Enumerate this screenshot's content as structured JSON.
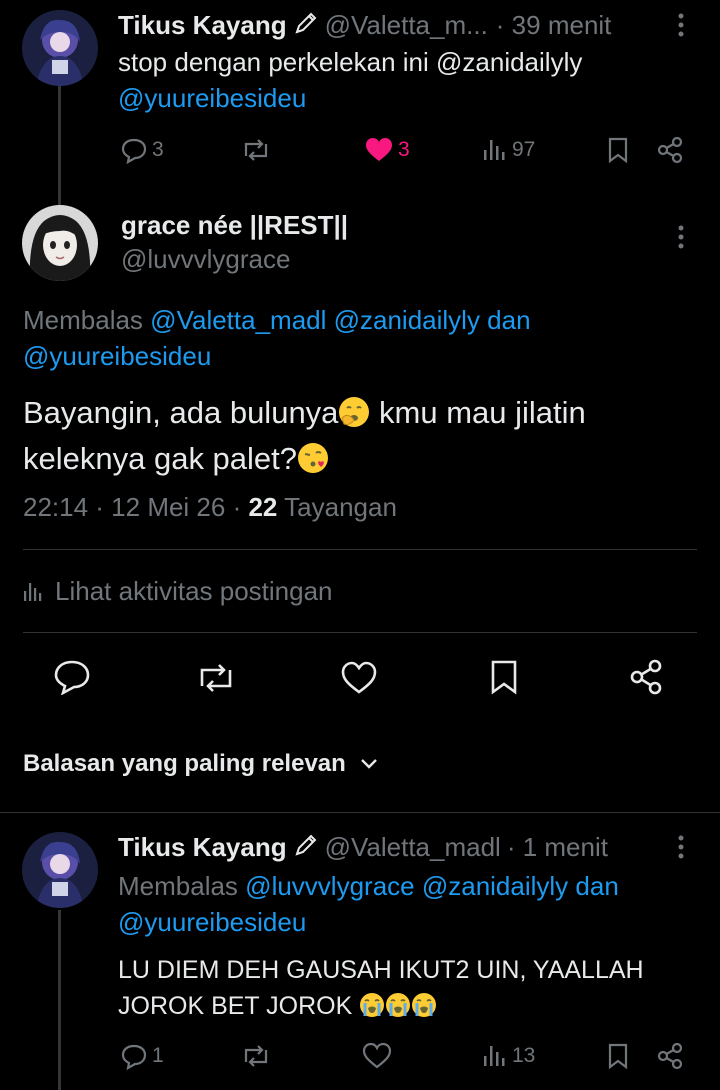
{
  "tweet1": {
    "display_name": "Tikus Kayang",
    "handle": "@Valetta_m...",
    "time": "· 39 menit",
    "text_line1": "stop dengan perkelekan ini @zanidailyly",
    "mention2": "@yuureibesideu",
    "replies": "3",
    "likes": "3",
    "views": "97",
    "more_icon": "more-vertical-icon"
  },
  "main_tweet": {
    "display_name": "grace née ||REST||",
    "handle": "@luvvvlygrace",
    "reply_prefix": "Membalas",
    "reply_mentions_line1": "@Valetta_madl @zanidailyly dan",
    "reply_mentions_line2": "@yuureibesideu",
    "text_line1": "Bayangin, ada bulunya",
    "text_line1b": " kmu mau jilatin",
    "text_line2": "keleknya gak palet?",
    "meta_time": "22:14 · 12 Mei 26 · ",
    "meta_views_count": "22",
    "meta_views_label": " Tayangan",
    "activity_link": "Lihat aktivitas postingan"
  },
  "replies_sort": {
    "label": "Balasan yang paling relevan"
  },
  "reply1": {
    "display_name": "Tikus Kayang",
    "handle": "@Valetta_madl",
    "time": "· 1 menit",
    "reply_prefix": "Membalas",
    "reply_mentions_line1": "@luvvvlygrace @zanidailyly dan",
    "reply_mentions_line2": "@yuureibesideu",
    "text_line1": "LU DIEM DEH GAUSAH IKUT2 UIN, YAALLAH",
    "text_line2": "JOROK BET JOROK",
    "replies": "1",
    "views": "13"
  },
  "colors": {
    "background": "#000000",
    "text": "#e7e9ea",
    "muted": "#71767b",
    "link": "#1d9bf0",
    "like": "#f91880"
  }
}
